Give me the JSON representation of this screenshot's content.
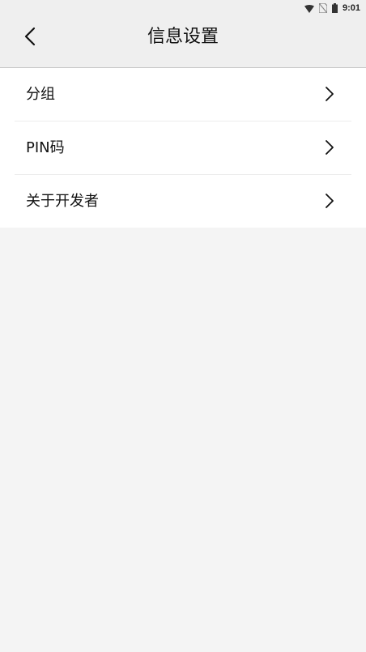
{
  "status_bar": {
    "time": "9:01",
    "icons": [
      "wifi-icon",
      "no-sim-icon",
      "battery-icon"
    ]
  },
  "header": {
    "title": "信息设置",
    "back_icon": "chevron-left-icon"
  },
  "menu": {
    "items": [
      {
        "label": "分组",
        "icon": "chevron-right-icon"
      },
      {
        "label": "PIN码",
        "icon": "chevron-right-icon"
      },
      {
        "label": "关于开发者",
        "icon": "chevron-right-icon"
      }
    ]
  }
}
